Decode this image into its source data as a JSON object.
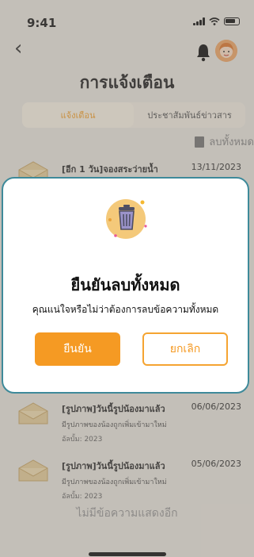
{
  "status_bar": {
    "time": "9:41"
  },
  "header": {
    "title": "การแจ้งเตือน"
  },
  "tabs": [
    {
      "label": "แจ้งเตือน",
      "active": true
    },
    {
      "label": "ประชาสัมพันธ์ข่าวสาร",
      "active": false
    }
  ],
  "delete_all_label": "ลบทั้งหมด",
  "notifications": [
    {
      "title": "[อีก 1 วัน]จองสระว่ายน้ำ",
      "date": "13/11/2023",
      "description": "",
      "album": ""
    },
    {
      "title": "[รูปภาพ]วันนี้รูปน้องมาแล้ว",
      "date": "06/06/2023",
      "description": "มีรูปภาพของน้องถูกเพิ่มเข้ามาใหม่",
      "album": "อัลบั้ม: 2023"
    },
    {
      "title": "[รูปภาพ]วันนี้รูปน้องมาแล้ว",
      "date": "05/06/2023",
      "description": "มีรูปภาพของน้องถูกเพิ่มเข้ามาใหม่",
      "album": "อัลบั้ม: 2023"
    }
  ],
  "footer": {
    "no_more": "ไม่มีข้อความแสดงอีก"
  },
  "modal": {
    "title": "ยืนยันลบทั้งหมด",
    "message": "คุณแน่ใจหรือไม่ว่าต้องการลบข้อความทั้งหมด",
    "confirm_label": "ยืนยัน",
    "cancel_label": "ยกเลิก"
  },
  "colors": {
    "accent": "#f59a23",
    "modal_border": "#3e8a9a"
  }
}
